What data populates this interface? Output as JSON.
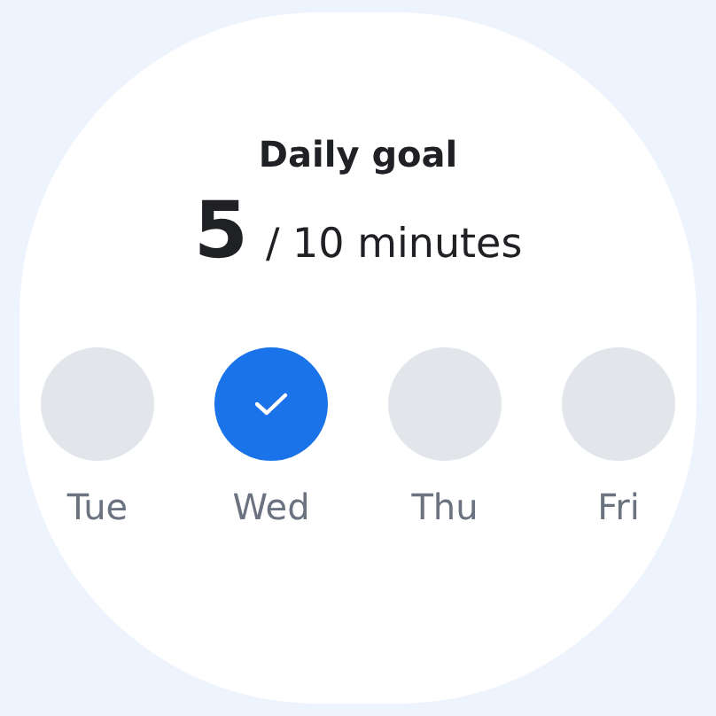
{
  "title": "Daily goal",
  "progress": {
    "value": "5",
    "target": "/ 10 minutes"
  },
  "days": [
    {
      "label": "Tue",
      "checked": false
    },
    {
      "label": "Wed",
      "checked": true
    },
    {
      "label": "Thu",
      "checked": false
    },
    {
      "label": "Fri",
      "checked": false
    }
  ]
}
